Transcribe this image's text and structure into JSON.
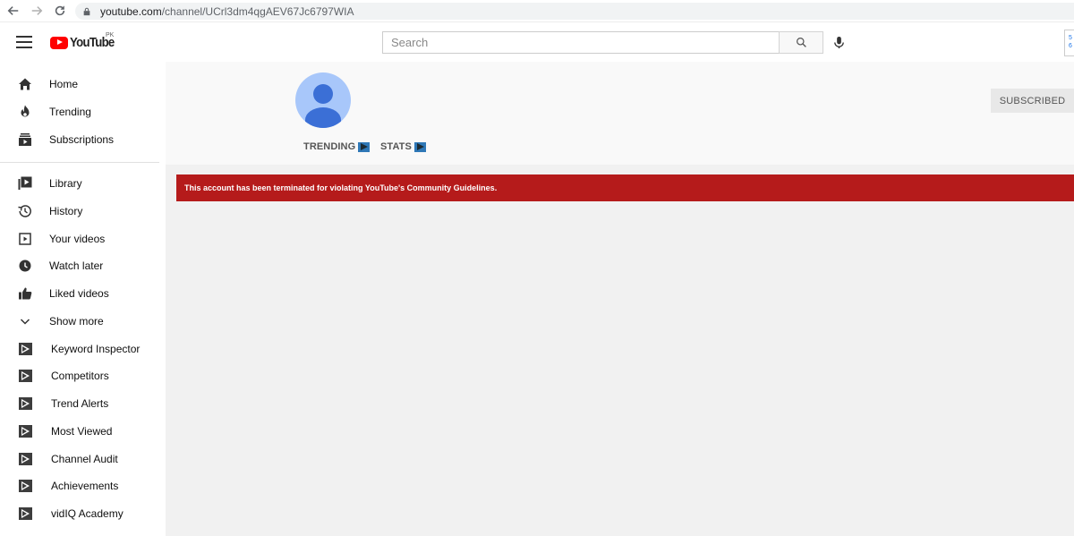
{
  "browser": {
    "url_domain": "youtube.com",
    "url_path": "/channel/UCrl3dm4qgAEV67Jc6797WIA"
  },
  "masthead": {
    "logo_text": "YouTube",
    "country_code": "PK",
    "search_placeholder": "Search",
    "widget_text": "5 6"
  },
  "sidebar": {
    "primary": [
      {
        "label": "Home",
        "icon": "home-icon"
      },
      {
        "label": "Trending",
        "icon": "trending-icon"
      },
      {
        "label": "Subscriptions",
        "icon": "subscriptions-icon"
      }
    ],
    "secondary": [
      {
        "label": "Library",
        "icon": "library-icon"
      },
      {
        "label": "History",
        "icon": "history-icon"
      },
      {
        "label": "Your videos",
        "icon": "your-videos-icon"
      },
      {
        "label": "Watch later",
        "icon": "watch-later-icon"
      },
      {
        "label": "Liked videos",
        "icon": "liked-videos-icon"
      },
      {
        "label": "Show more",
        "icon": "chevron-down-icon"
      }
    ],
    "vidiq": [
      {
        "label": "Keyword Inspector"
      },
      {
        "label": "Competitors"
      },
      {
        "label": "Trend Alerts"
      },
      {
        "label": "Most Viewed"
      },
      {
        "label": "Channel Audit"
      },
      {
        "label": "Achievements"
      },
      {
        "label": "vidIQ Academy"
      }
    ]
  },
  "channel": {
    "tabs": [
      {
        "label": "TRENDING"
      },
      {
        "label": "STATS"
      }
    ],
    "subscribed_label": "SUBSCRIBED",
    "alert_message": "This account has been terminated for violating YouTube's Community Guidelines."
  },
  "colors": {
    "alert_bg": "#b51b1b",
    "brand_red": "#ff0000",
    "avatar_bg": "#a8c7fa",
    "avatar_fg": "#3b6fd6"
  }
}
